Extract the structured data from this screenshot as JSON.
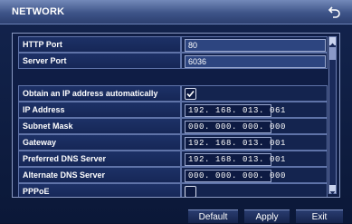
{
  "window": {
    "title": "NETWORK"
  },
  "rows": [
    {
      "label": "HTTP Port",
      "value": "80"
    },
    {
      "label": "Server Port",
      "value": "6036"
    },
    {
      "label": "Obtain an IP address automatically",
      "checked": true
    },
    {
      "label": "IP Address",
      "value": "192. 168. 013. 061"
    },
    {
      "label": "Subnet Mask",
      "value": "000. 000. 000. 000"
    },
    {
      "label": "Gateway",
      "value": "192. 168. 013. 001"
    },
    {
      "label": "Preferred DNS Server",
      "value": "192. 168. 013. 001"
    },
    {
      "label": "Alternate DNS Server",
      "value": "000. 000. 000. 000"
    },
    {
      "label": "PPPoE",
      "checked": false
    }
  ],
  "buttons": {
    "default": "Default",
    "apply": "Apply",
    "exit": "Exit"
  },
  "icons": {
    "back": "back-arrow-icon",
    "check": "checkmark-icon"
  },
  "colors": {
    "background": "#0f1d45",
    "titlebar": "#3e5488",
    "border": "#5f73a8"
  }
}
